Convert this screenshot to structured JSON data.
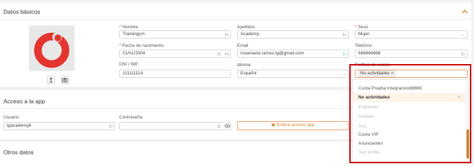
{
  "datos_basicos": {
    "title": "Datos básicos",
    "collapse_icon": "chevron-up-icon",
    "avatar_actions": [
      "upload-icon",
      "camera-icon"
    ],
    "nombre": {
      "label": "Nombre",
      "value": "Trainingym"
    },
    "apellidos": {
      "label": "Apellidos",
      "value": "Academy"
    },
    "sexo": {
      "label": "Sexo",
      "value": "Mujer"
    },
    "fecha": {
      "label": "Fecha de nacimiento",
      "value": "01/01/2004"
    },
    "email": {
      "label": "Email",
      "value": "rosamaria.ramos.tg@gmail.com"
    },
    "telefono": {
      "label": "Telefono",
      "value": "666666666"
    },
    "dni": {
      "label": "DNI / NIE",
      "value": "11111111A"
    },
    "idioma": {
      "label": "Idioma",
      "value": "Español"
    },
    "perfiles": {
      "label": "Perfiles de socios",
      "tag": "No actividades",
      "options": [
        {
          "label": "Cuota Prueba Integracion88889",
          "state": "normal"
        },
        {
          "label": "No actividades",
          "state": "selected"
        },
        {
          "label": "Empleado",
          "state": "disabled"
        },
        {
          "label": "Invitado",
          "state": "disabled"
        },
        {
          "label": "Test",
          "state": "disabled"
        },
        {
          "label": "Cuota VIP",
          "state": "normal"
        },
        {
          "label": "Anunciantes",
          "state": "normal"
        },
        {
          "label": "Test profile",
          "state": "disabled"
        }
      ]
    }
  },
  "acceso": {
    "title": "Acceso a la app",
    "usuario": {
      "label": "Usuario",
      "value": "tgacademy6"
    },
    "contrasena": {
      "label": "Contraseña",
      "value": ""
    },
    "enlace_button": "Enlace acceso app"
  },
  "otros": {
    "title": "Otros datos"
  },
  "colors": {
    "accent": "#e4352f",
    "orange": "#d9822b",
    "highlight": "#cc0000",
    "selected_bg": "#fdf3e7"
  }
}
